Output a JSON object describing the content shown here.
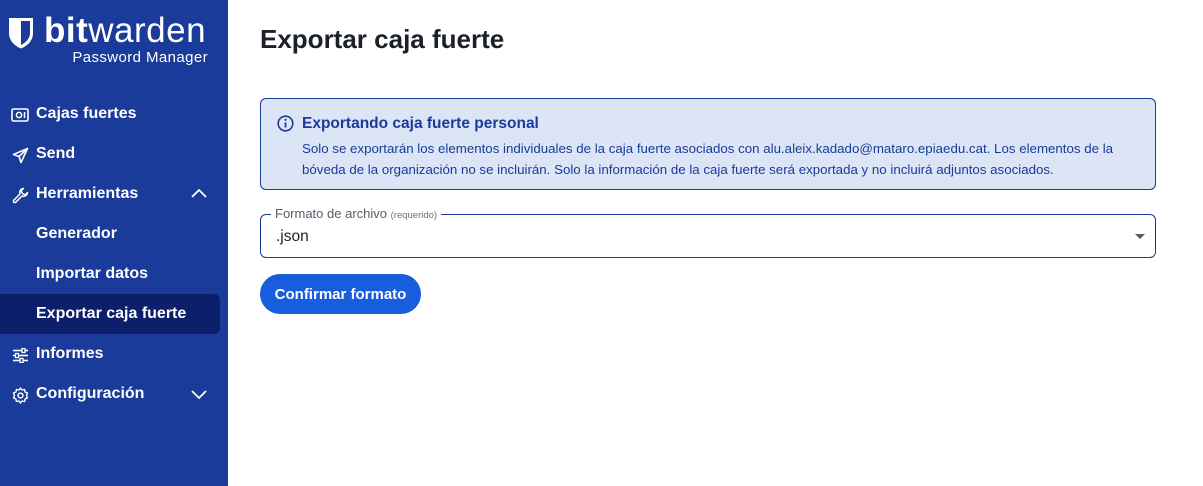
{
  "brand": {
    "name_bold": "bit",
    "name_regular": "warden",
    "tagline": "Password Manager"
  },
  "sidebar": {
    "items": [
      {
        "label": "Cajas fuertes",
        "icon": "vault-icon"
      },
      {
        "label": "Send",
        "icon": "paper-plane-icon"
      },
      {
        "label": "Herramientas",
        "icon": "wrench-icon",
        "expanded": true,
        "children": [
          {
            "label": "Generador"
          },
          {
            "label": "Importar datos"
          },
          {
            "label": "Exportar caja fuerte",
            "active": true
          }
        ]
      },
      {
        "label": "Informes",
        "icon": "sliders-icon"
      },
      {
        "label": "Configuración",
        "icon": "gear-icon",
        "expanded": false
      }
    ]
  },
  "main": {
    "title": "Exportar caja fuerte",
    "callout": {
      "title": "Exportando caja fuerte personal",
      "body": "Solo se exportarán los elementos individuales de la caja fuerte asociados con alu.aleix.kadado@mataro.epiaedu.cat. Los elementos de la bóveda de la organización no se incluirán. Solo la información de la caja fuerte será exportada y no incluirá adjuntos asociados."
    },
    "format_field": {
      "label": "Formato de archivo",
      "required_hint": "(requerido)",
      "value": ".json"
    },
    "confirm_button": "Confirmar formato"
  },
  "colors": {
    "sidebar": "#1a3b9a",
    "active_item": "#0c1f6b",
    "primary_button": "#175ddc",
    "callout_bg": "#dbe5f6"
  }
}
